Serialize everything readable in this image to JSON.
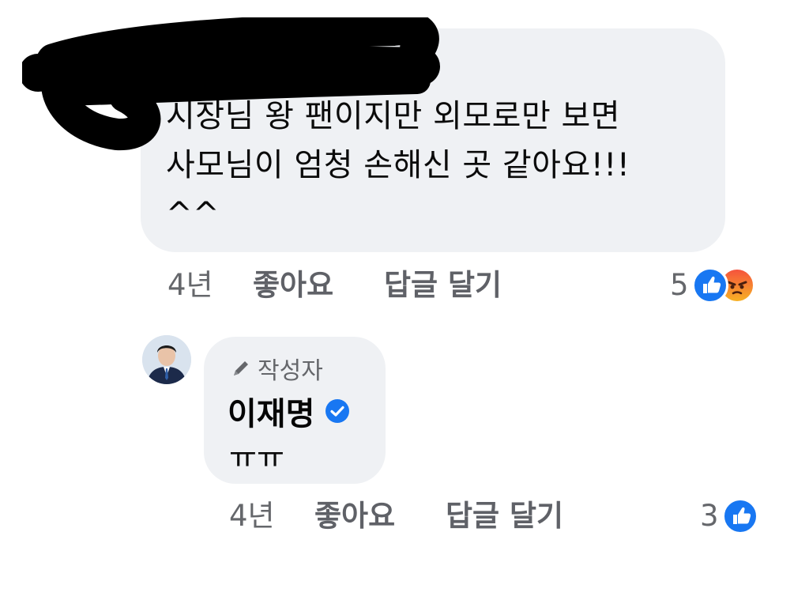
{
  "comment_1": {
    "text_lines": [
      "시장님 왕 팬이지만 외모로만 보면",
      "사모님이 엄청 손해신 곳 같아요!!!",
      "^^"
    ],
    "time": "4년",
    "like_label": "좋아요",
    "reply_label": "답글 달기",
    "reaction_count": "5",
    "reaction_icons": [
      "like-icon",
      "angry-icon"
    ]
  },
  "comment_2": {
    "author_badge": "작성자",
    "author_name": "이재명",
    "text": "ㅠㅠ",
    "time": "4년",
    "like_label": "좋아요",
    "reply_label": "답글 달기",
    "reaction_count": "3",
    "reaction_icons": [
      "like-icon"
    ]
  },
  "colors": {
    "bubble_bg": "#eff1f4",
    "meta_text": "#65676b",
    "like_blue": "#1877f2",
    "redaction": "#000000"
  }
}
